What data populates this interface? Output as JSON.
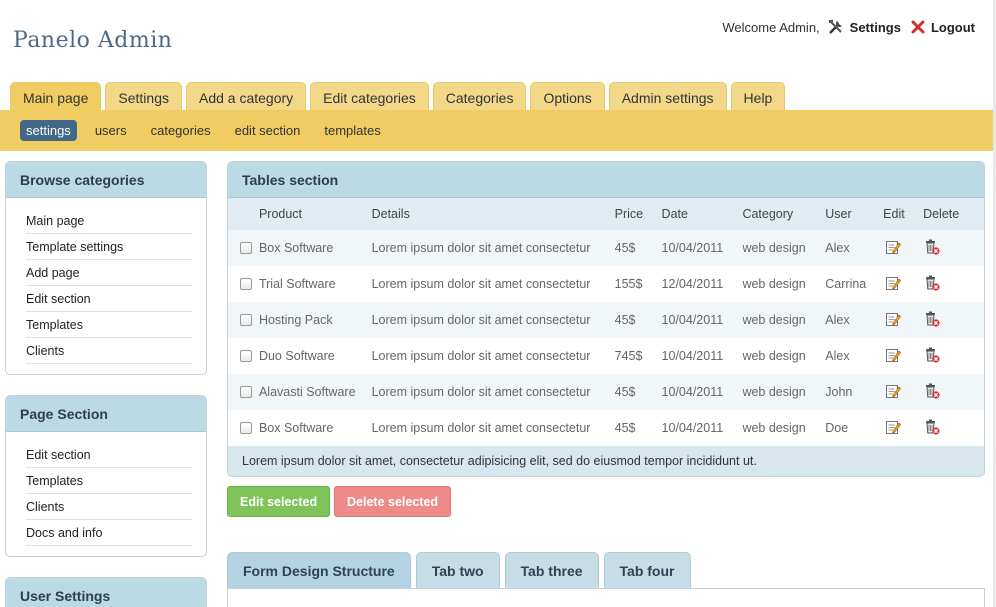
{
  "app": {
    "title": "Panelo Admin"
  },
  "topbar": {
    "welcome": "Welcome Admin,",
    "settings_label": "Settings",
    "logout_label": "Logout"
  },
  "tabs": [
    {
      "label": "Main page",
      "active": true
    },
    {
      "label": "Settings"
    },
    {
      "label": "Add a category"
    },
    {
      "label": "Edit categories"
    },
    {
      "label": "Categories"
    },
    {
      "label": "Options"
    },
    {
      "label": "Admin settings"
    },
    {
      "label": "Help"
    }
  ],
  "subnav": [
    {
      "label": "settings",
      "active": true
    },
    {
      "label": "users"
    },
    {
      "label": "categories"
    },
    {
      "label": "edit section"
    },
    {
      "label": "templates"
    }
  ],
  "sidebar": [
    {
      "title": "Browse categories",
      "items": [
        "Main page",
        "Template settings",
        "Add page",
        "Edit section",
        "Templates",
        "Clients"
      ]
    },
    {
      "title": "Page Section",
      "items": [
        "Edit section",
        "Templates",
        "Clients",
        "Docs and info"
      ]
    },
    {
      "title": "User Settings",
      "items": []
    }
  ],
  "table": {
    "title": "Tables section",
    "headers": [
      "Product",
      "Details",
      "Price",
      "Date",
      "Category",
      "User",
      "Edit",
      "Delete"
    ],
    "rows": [
      [
        "Box Software",
        "Lorem ipsum dolor sit amet consectetur",
        "45$",
        "10/04/2011",
        "web design",
        "Alex"
      ],
      [
        "Trial Software",
        "Lorem ipsum dolor sit amet consectetur",
        "155$",
        "12/04/2011",
        "web design",
        "Carrina"
      ],
      [
        "Hosting Pack",
        "Lorem ipsum dolor sit amet consectetur",
        "45$",
        "10/04/2011",
        "web design",
        "Alex"
      ],
      [
        "Duo Software",
        "Lorem ipsum dolor sit amet consectetur",
        "745$",
        "10/04/2011",
        "web design",
        "Alex"
      ],
      [
        "Alavasti Software",
        "Lorem ipsum dolor sit amet consectetur",
        "45$",
        "10/04/2011",
        "web design",
        "John"
      ],
      [
        "Box Software",
        "Lorem ipsum dolor sit amet consectetur",
        "45$",
        "10/04/2011",
        "web design",
        "Doe"
      ]
    ],
    "footer": "Lorem ipsum dolor sit amet, consectetur adipisicing elit, sed do eiusmod tempor incididunt ut."
  },
  "buttons": {
    "edit_selected": "Edit selected",
    "delete_selected": "Delete selected"
  },
  "form_tabs": [
    {
      "label": "Form Design Structure",
      "active": true
    },
    {
      "label": "Tab two"
    },
    {
      "label": "Tab three"
    },
    {
      "label": "Tab four"
    }
  ],
  "icons": {
    "settings": "tools-icon",
    "logout": "close-icon",
    "edit": "edit-icon",
    "delete": "trash-icon"
  },
  "colors": {
    "accent_yellow": "#f0cc62",
    "header_blue": "#bcd9e6",
    "active_subnav": "#416887",
    "edit_btn": "#7ec45a",
    "delete_btn": "#ee8a8a"
  }
}
